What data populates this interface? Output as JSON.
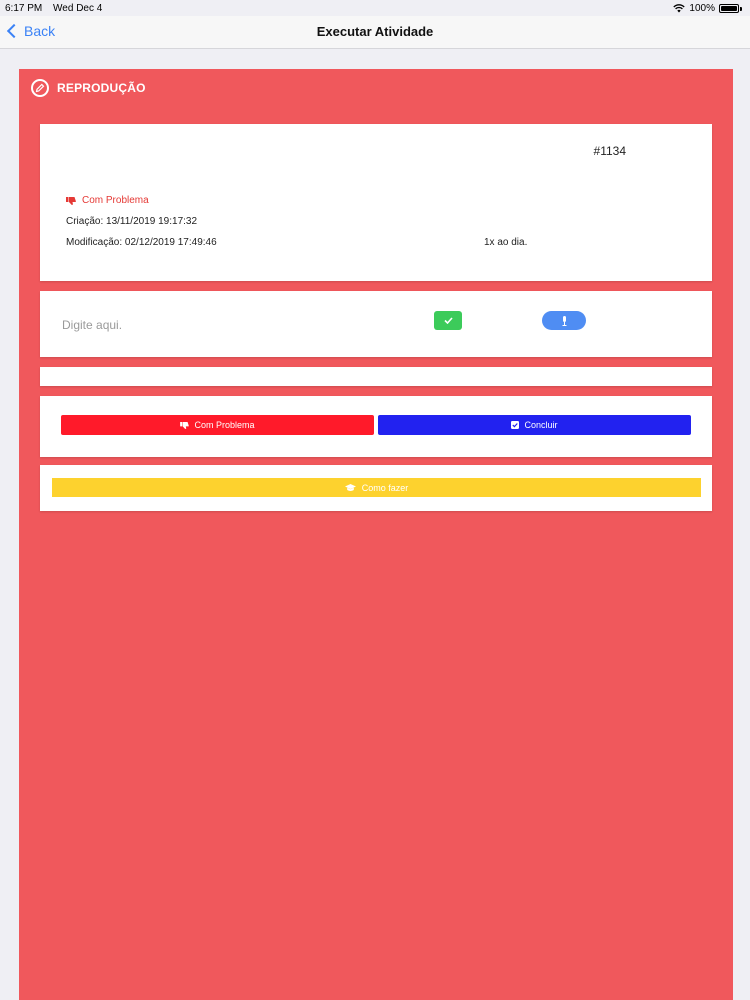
{
  "status_bar": {
    "time": "6:17 PM",
    "date": "Wed Dec 4",
    "battery": "100%"
  },
  "nav": {
    "back_label": "Back",
    "title": "Executar Atividade"
  },
  "section": {
    "title": "REPRODUÇÃO"
  },
  "info_card": {
    "ticket_id": "#1134",
    "status_label": "Com Problema",
    "created": "Criação: 13/11/2019 19:17:32",
    "modified": "Modificação: 02/12/2019 17:49:46",
    "frequency": "1x ao dia."
  },
  "input_card": {
    "placeholder": "Digite aqui."
  },
  "actions": {
    "problem_label": "Com Problema",
    "conclude_label": "Concluir"
  },
  "howto": {
    "label": "Como fazer"
  },
  "colors": {
    "panel": "#f0585c",
    "problem_button": "#ff1a2a",
    "conclude_button": "#2222f0",
    "confirm_button": "#3ccb5a",
    "mic_button": "#4f8df3",
    "howto_button": "#fdd22e",
    "link_blue": "#3b82f6"
  }
}
